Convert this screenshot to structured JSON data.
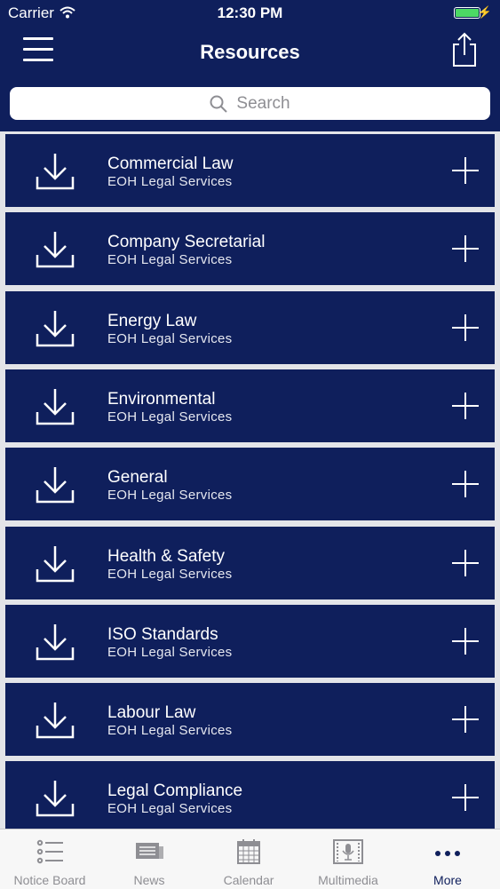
{
  "status": {
    "carrier": "Carrier",
    "time": "12:30 PM"
  },
  "nav": {
    "title": "Resources"
  },
  "search": {
    "placeholder": "Search"
  },
  "items": [
    {
      "name": "Commercial Law",
      "sub": "EOH Legal Services"
    },
    {
      "name": "Company Secretarial",
      "sub": "EOH Legal Services"
    },
    {
      "name": "Energy Law",
      "sub": "EOH Legal Services"
    },
    {
      "name": "Environmental",
      "sub": "EOH Legal Services"
    },
    {
      "name": "General",
      "sub": "EOH Legal Services"
    },
    {
      "name": "Health & Safety",
      "sub": "EOH Legal Services"
    },
    {
      "name": "ISO Standards",
      "sub": "EOH Legal Services"
    },
    {
      "name": "Labour Law",
      "sub": "EOH Legal Services"
    },
    {
      "name": "Legal Compliance",
      "sub": "EOH Legal Services"
    }
  ],
  "tabs": [
    {
      "label": "Notice Board",
      "icon": "list-icon"
    },
    {
      "label": "News",
      "icon": "newspaper-icon"
    },
    {
      "label": "Calendar",
      "icon": "calendar-icon"
    },
    {
      "label": "Multimedia",
      "icon": "microphone-film-icon"
    },
    {
      "label": "More",
      "icon": "more-dots-icon"
    }
  ],
  "colors": {
    "primary": "#0f1f5c",
    "background": "#e3e4e8",
    "tab_inactive": "#8e8e93",
    "battery": "#4cd964"
  }
}
